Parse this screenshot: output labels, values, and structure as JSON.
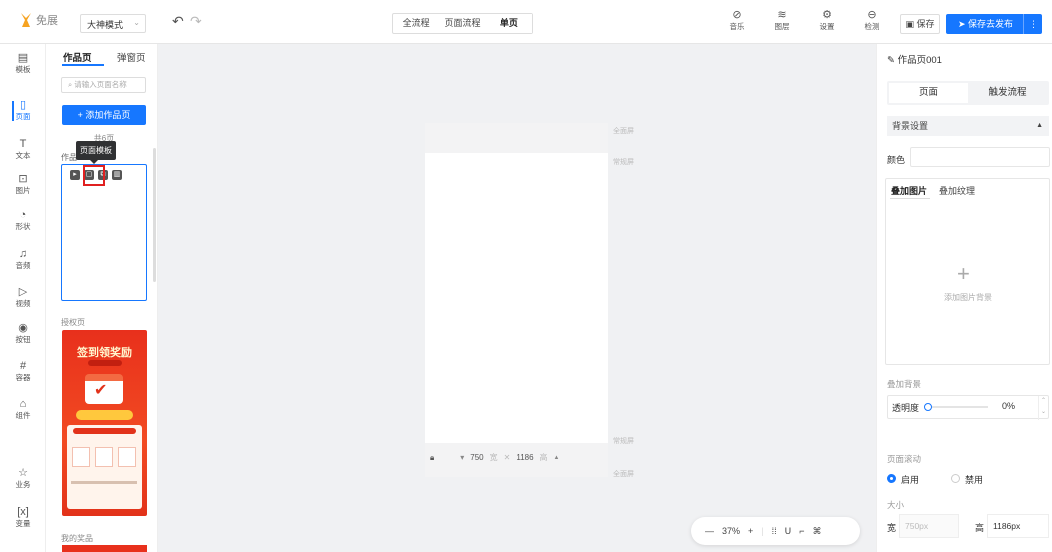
{
  "topbar": {
    "logo_text": "免展",
    "mode": "大神模式",
    "flow_tabs": [
      "全流程",
      "页面流程",
      "单页"
    ],
    "tools": [
      {
        "icon": "music-icon",
        "label": "音乐"
      },
      {
        "icon": "layers-icon",
        "label": "图层"
      },
      {
        "icon": "gear-icon",
        "label": "设置"
      },
      {
        "icon": "detect-icon",
        "label": "检测"
      }
    ],
    "save": "保存",
    "publish": "保存去发布"
  },
  "rail": [
    {
      "icon": "template-icon",
      "label": "模板"
    },
    {
      "icon": "page-icon",
      "label": "页面"
    },
    {
      "icon": "text-icon",
      "label": "文本"
    },
    {
      "icon": "image-icon",
      "label": "图片"
    },
    {
      "icon": "shape-icon",
      "label": "形状"
    },
    {
      "icon": "audio-icon",
      "label": "音频"
    },
    {
      "icon": "video-icon",
      "label": "视频"
    },
    {
      "icon": "button-icon",
      "label": "按钮"
    },
    {
      "icon": "container-icon",
      "label": "容器"
    },
    {
      "icon": "component-icon",
      "label": "组件"
    },
    {
      "icon": "business-icon",
      "label": "业务"
    },
    {
      "icon": "variable-icon",
      "label": "变量"
    }
  ],
  "pages": {
    "tabs": [
      "作品页",
      "弹窗页"
    ],
    "search_placeholder": "请输入页面名称",
    "add_button": "+ 添加作品页",
    "count": "共6页",
    "group_title": "作品",
    "tooltip": "页面模板",
    "section2": "授权页",
    "promo_title": "签到领奖励",
    "section3": "我的奖品"
  },
  "canvas": {
    "full_screen_top": "全面屏",
    "normal_screen_top": "常规屏",
    "normal_screen_bottom": "常规屏",
    "full_screen_bottom": "全面屏",
    "width": "750",
    "width_unit": "宽",
    "height": "1186",
    "height_unit": "高",
    "zoom": "37%"
  },
  "right": {
    "title": "作品页001",
    "tabs": [
      "页面",
      "触发流程"
    ],
    "bg_section": "背景设置",
    "color_label": "颜色",
    "overlay_tabs": [
      "叠加图片",
      "叠加纹理"
    ],
    "add_bg": "添加图片背景",
    "overlay_bg": "叠加背景",
    "opacity_label": "透明度",
    "opacity_value": "0%",
    "scroll_label": "页面滚动",
    "enable": "启用",
    "disable": "禁用",
    "size_label": "大小",
    "width_label": "宽",
    "width_value": "750px",
    "height_label": "高",
    "height_value": "1186px"
  },
  "colors": {
    "accent": "#1677ff",
    "highlight": "#e02020"
  }
}
